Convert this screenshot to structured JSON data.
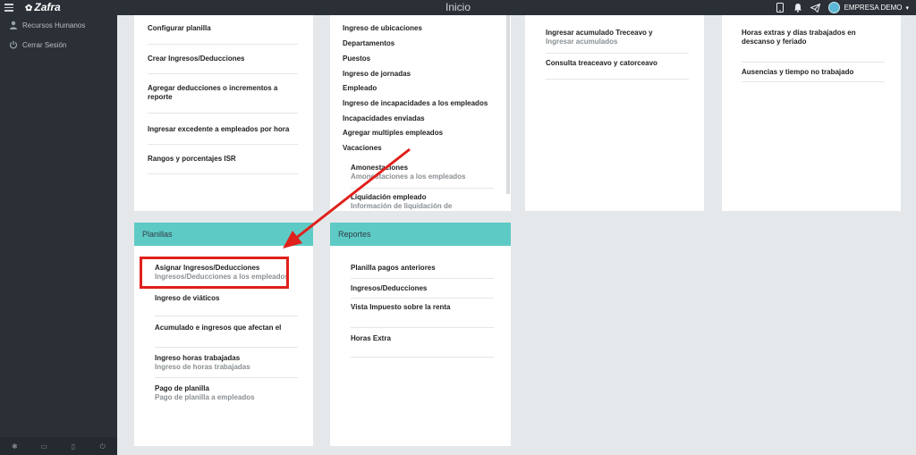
{
  "topbar": {
    "logo_text": "Zafra",
    "page_title": "Inicio",
    "company_name": "EMPRESA DEMO",
    "icons": [
      "menu-icon",
      "mobile-icon",
      "bell-icon",
      "send-icon",
      "avatar",
      "chevron-down-icon"
    ]
  },
  "sidebar": {
    "items": [
      {
        "label": "Recursos Humanos",
        "icon": "user-icon"
      },
      {
        "label": "Cerrar Sesión",
        "icon": "power-icon"
      }
    ],
    "bottom_icons": [
      "gear-icon",
      "window-icon",
      "lock-icon",
      "power-icon"
    ]
  },
  "card1": {
    "items": [
      {
        "label": "Configurar planilla"
      },
      {
        "label": "Crear Ingresos/Deducciones"
      },
      {
        "label": "Agregar deducciones o incrementos a reporte"
      },
      {
        "label": "Ingresar excedente a empleados por hora"
      },
      {
        "label": "Rangos y porcentajes ISR"
      }
    ]
  },
  "card2": {
    "items": [
      {
        "label": "Ingreso de ubicaciones"
      },
      {
        "label": "Departamentos"
      },
      {
        "label": "Puestos"
      },
      {
        "label": "Ingreso de jornadas"
      },
      {
        "label": "Empleado"
      },
      {
        "label": "Ingreso de incapacidades a los empleados"
      },
      {
        "label": "Incapacidades enviadas"
      },
      {
        "label": "Agregar multiples empleados"
      },
      {
        "label": "Vacaciones"
      }
    ],
    "subitems": [
      {
        "label": "Amonestaciones",
        "sub": "Amonestaciones a los empleados"
      },
      {
        "label": "Liquidación empleado",
        "sub": "Información de liquidación de"
      }
    ]
  },
  "card3": {
    "items": [
      {
        "label": "Ingresar acumulado Treceavo y",
        "sub": "Ingresar acumulados"
      },
      {
        "label": "Consulta treaceavo y catorceavo"
      }
    ]
  },
  "card4": {
    "items": [
      {
        "label": "Horas extras y días trabajados en descanso y feriado"
      },
      {
        "label": "Ausencias y tiempo no trabajado"
      }
    ]
  },
  "planillas": {
    "title": "Planillas",
    "items": [
      {
        "label": "Asignar Ingresos/Deducciones",
        "sub": "Ingresos/Deducciones a los empleados"
      },
      {
        "label": "Ingreso de viáticos"
      },
      {
        "label": "Acumulado e ingresos que afectan el"
      },
      {
        "label": "Ingreso horas trabajadas",
        "sub": "Ingreso de horas trabajadas"
      },
      {
        "label": "Pago de planilla",
        "sub": "Pago de planilla a empleados"
      }
    ]
  },
  "reportes": {
    "title": "Reportes",
    "items": [
      {
        "label": "Planilla pagos anteriores"
      },
      {
        "label": "Ingresos/Deducciones"
      },
      {
        "label": "Vista Impuesto sobre la renta"
      },
      {
        "label": "Horas Extra"
      }
    ]
  },
  "colors": {
    "header_bg": "#2a3036",
    "card_head": "#5ecac5",
    "annotation": "#e0201b",
    "page_bg": "#e4e8eb"
  }
}
